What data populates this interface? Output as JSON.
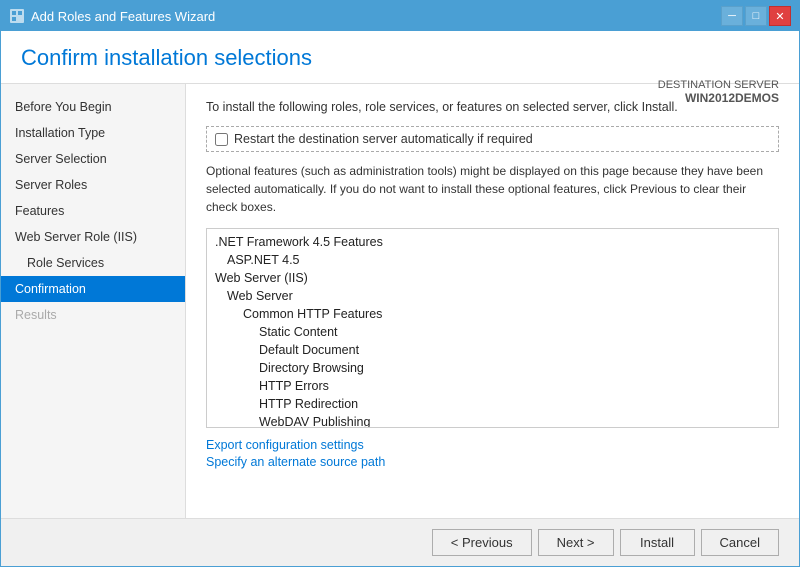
{
  "window": {
    "title": "Add Roles and Features Wizard",
    "title_icon": "wizard-icon"
  },
  "title_buttons": {
    "minimize": "─",
    "restore": "□",
    "close": "✕"
  },
  "header": {
    "title": "Confirm installation selections",
    "dest_server_label": "DESTINATION SERVER",
    "dest_server_name": "WIN2012DEMOS"
  },
  "sidebar": {
    "items": [
      {
        "label": "Before You Begin",
        "state": "normal",
        "indent": false
      },
      {
        "label": "Installation Type",
        "state": "normal",
        "indent": false
      },
      {
        "label": "Server Selection",
        "state": "normal",
        "indent": false
      },
      {
        "label": "Server Roles",
        "state": "normal",
        "indent": false
      },
      {
        "label": "Features",
        "state": "normal",
        "indent": false
      },
      {
        "label": "Web Server Role (IIS)",
        "state": "normal",
        "indent": false
      },
      {
        "label": "Role Services",
        "state": "normal",
        "indent": true
      },
      {
        "label": "Confirmation",
        "state": "active",
        "indent": false
      },
      {
        "label": "Results",
        "state": "disabled",
        "indent": false
      }
    ]
  },
  "content": {
    "intro": "To install the following roles, role services, or features on selected server, click Install.",
    "checkbox_label": "Restart the destination server automatically if required",
    "optional_note": "Optional features (such as administration tools) might be displayed on this page because they have been selected automatically. If you do not want to install these optional features, click Previous to clear their check boxes.",
    "features": [
      {
        "label": ".NET Framework 4.5 Features",
        "indent": 0
      },
      {
        "label": "ASP.NET 4.5",
        "indent": 1
      },
      {
        "label": "Web Server (IIS)",
        "indent": 0
      },
      {
        "label": "Web Server",
        "indent": 1
      },
      {
        "label": "Common HTTP Features",
        "indent": 2
      },
      {
        "label": "Static Content",
        "indent": 3
      },
      {
        "label": "Default Document",
        "indent": 3
      },
      {
        "label": "Directory Browsing",
        "indent": 3
      },
      {
        "label": "HTTP Errors",
        "indent": 3
      },
      {
        "label": "HTTP Redirection",
        "indent": 3
      },
      {
        "label": "WebDAV Publishing",
        "indent": 3
      }
    ],
    "links": [
      "Export configuration settings",
      "Specify an alternate source path"
    ]
  },
  "footer": {
    "previous_label": "< Previous",
    "next_label": "Next >",
    "install_label": "Install",
    "cancel_label": "Cancel"
  }
}
